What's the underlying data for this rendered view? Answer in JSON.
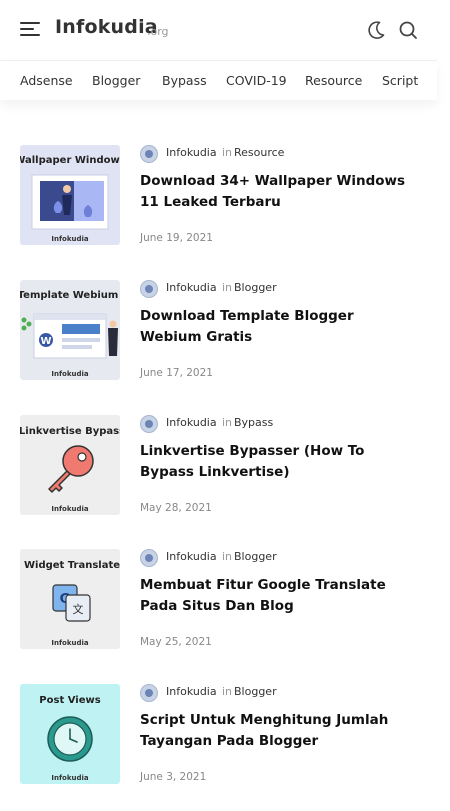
{
  "header": {
    "brand": "Infokudia",
    "brand_tld": ".org"
  },
  "icons": {
    "menu": "hamburger-icon",
    "dark_mode": "moon-icon",
    "search": "search-icon"
  },
  "nav": {
    "items": [
      "Adsense",
      "Blogger",
      "Bypass",
      "COVID-19",
      "Resource",
      "Script"
    ]
  },
  "posts": [
    {
      "thumb_label": "Wallpaper Windows",
      "thumb_caption": "Infokudia",
      "thumb_bg": "#dfe3f3",
      "author": "Infokudia",
      "in_text": "in",
      "category": "Resource",
      "title": "Download 34+ Wallpaper Windows 11 Leaked Terbaru",
      "date": "June 19, 2021"
    },
    {
      "thumb_label": "Template Webium",
      "thumb_caption": "Infokudia",
      "thumb_bg": "#e7e9f1",
      "author": "Infokudia",
      "in_text": "in",
      "category": "Blogger",
      "title": "Download Template Blogger Webium Gratis",
      "date": "June 17, 2021"
    },
    {
      "thumb_label": "Linkvertise Bypass",
      "thumb_caption": "Infokudia",
      "thumb_bg": "#eeeeee",
      "author": "Infokudia",
      "in_text": "in",
      "category": "Bypass",
      "title": "Linkvertise Bypasser (How To Bypass Linkvertise)",
      "date": "May 28, 2021"
    },
    {
      "thumb_label": "Widget Translate",
      "thumb_caption": "Infokudia",
      "thumb_bg": "#eeeeee",
      "author": "Infokudia",
      "in_text": "in",
      "category": "Blogger",
      "title": "Membuat Fitur Google Translate Pada Situs Dan Blog",
      "date": "May 25, 2021"
    },
    {
      "thumb_label": "Post Views",
      "thumb_caption": "Infokudia",
      "thumb_bg": "#bff3f3",
      "author": "Infokudia",
      "in_text": "in",
      "category": "Blogger",
      "title": "Script Untuk Menghitung Jumlah Tayangan Pada Blogger",
      "date": "June 3, 2021"
    }
  ]
}
